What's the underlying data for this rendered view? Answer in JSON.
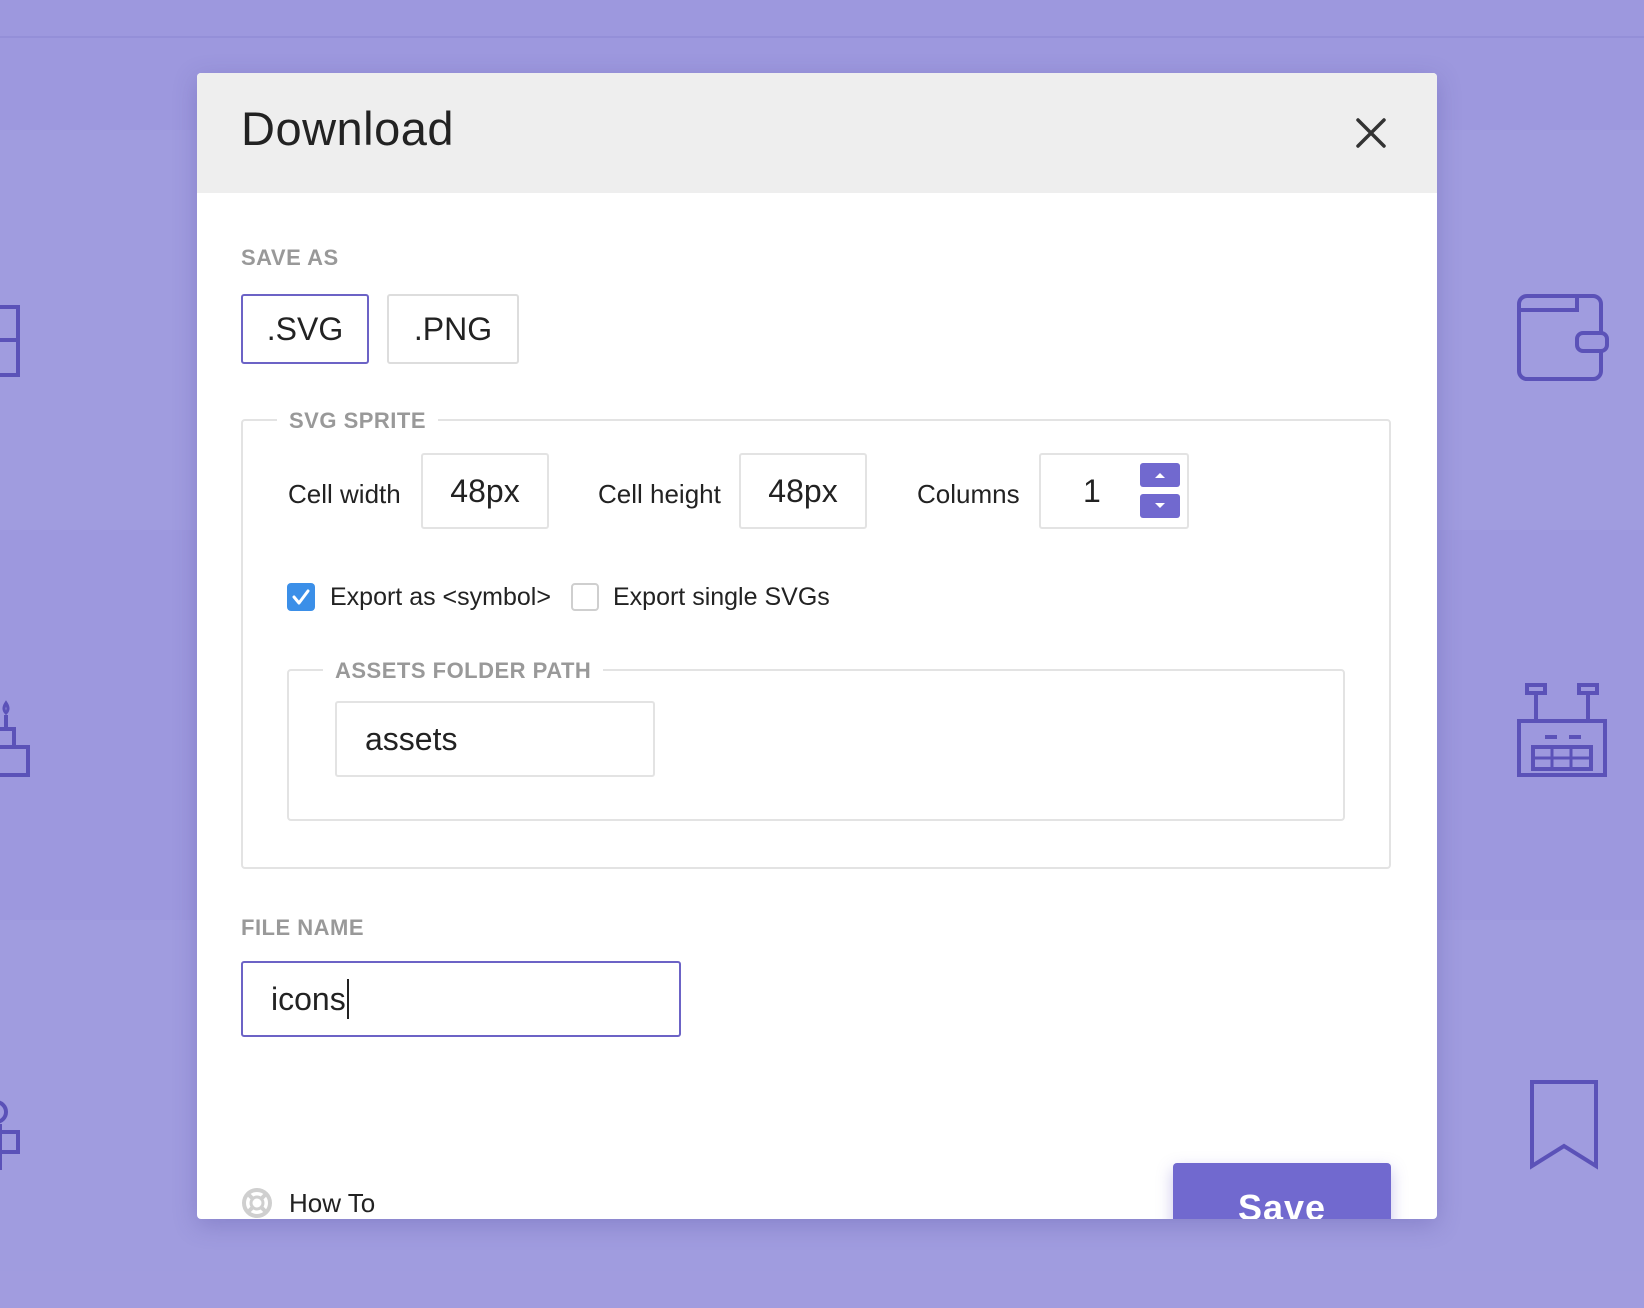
{
  "dialog": {
    "title": "Download",
    "close_icon": "close-icon"
  },
  "save_as": {
    "label": "SAVE AS",
    "formats": [
      {
        "label": ".SVG",
        "selected": true
      },
      {
        "label": ".PNG",
        "selected": false
      }
    ]
  },
  "svg_sprite": {
    "legend": "SVG SPRITE",
    "cell_width_label": "Cell width",
    "cell_width_value": "48px",
    "cell_height_label": "Cell height",
    "cell_height_value": "48px",
    "columns_label": "Columns",
    "columns_value": "1",
    "export_symbol_label": "Export as <symbol>",
    "export_symbol_checked": true,
    "export_single_label": "Export single SVGs",
    "export_single_checked": false,
    "assets": {
      "legend": "ASSETS FOLDER PATH",
      "value": "assets"
    }
  },
  "file_name": {
    "label": "FILE NAME",
    "value": "icons"
  },
  "footer": {
    "howto_label": "How To",
    "howto_icon": "lifebuoy-icon",
    "save_label": "Save"
  },
  "colors": {
    "backdrop": "#9d98de",
    "accent": "#7169cf",
    "checkbox_checked": "#3b8fe8",
    "header_bg": "#eeeeee"
  },
  "background_icons": [
    "wallet-icon",
    "cash-register-icon",
    "bookmark-icon",
    "birthday-cake-icon",
    "mug-icon"
  ]
}
